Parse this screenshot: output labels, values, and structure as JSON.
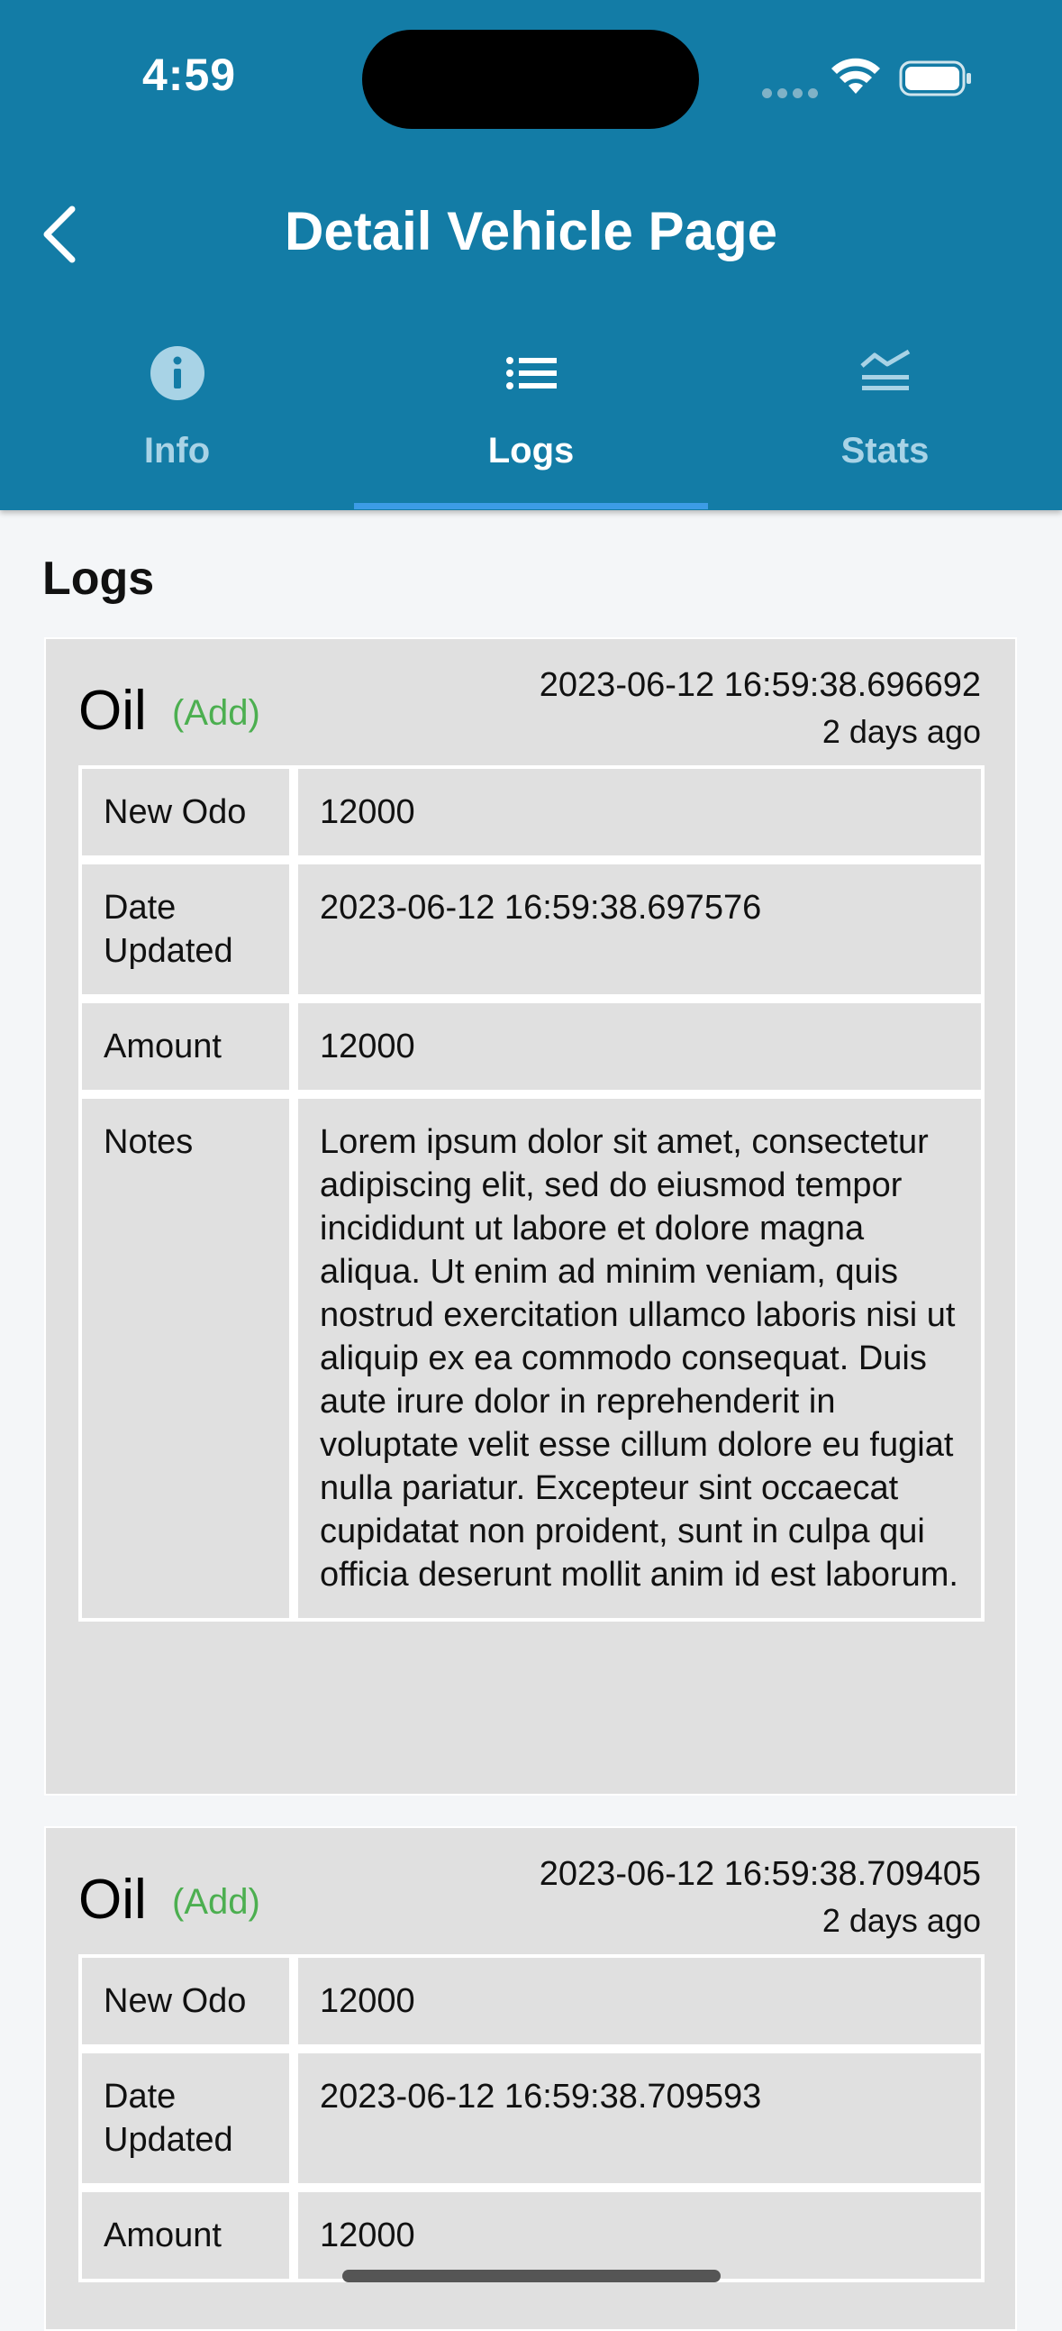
{
  "status_bar": {
    "time": "4:59"
  },
  "header": {
    "title": "Detail Vehicle Page"
  },
  "tabs": [
    {
      "label": "Info",
      "icon": "info-icon",
      "active": false
    },
    {
      "label": "Logs",
      "icon": "list-icon",
      "active": true
    },
    {
      "label": "Stats",
      "icon": "stats-icon",
      "active": false
    }
  ],
  "section_title": "Logs",
  "logs": [
    {
      "type": "Oil",
      "action": "(Add)",
      "timestamp": "2023-06-12 16:59:38.696692",
      "ago": "2 days ago",
      "rows": [
        {
          "key": "New Odo",
          "value": "12000"
        },
        {
          "key": "Date Updated",
          "value": "2023-06-12 16:59:38.697576"
        },
        {
          "key": "Amount",
          "value": "12000"
        },
        {
          "key": "Notes",
          "value": "Lorem ipsum dolor sit amet, consectetur adipiscing elit, sed do eiusmod tempor incididunt ut labore et dolore magna aliqua. Ut enim ad minim veniam, quis nostrud exercitation ullamco laboris nisi ut aliquip ex ea commodo consequat. Duis aute irure dolor in reprehenderit in voluptate velit esse cillum dolore eu fugiat nulla pariatur. Excepteur sint occaecat cupidatat non proident, sunt in culpa qui officia deserunt mollit anim id est laborum."
        }
      ]
    },
    {
      "type": "Oil",
      "action": "(Add)",
      "timestamp": "2023-06-12 16:59:38.709405",
      "ago": "2 days ago",
      "rows": [
        {
          "key": "New Odo",
          "value": "12000"
        },
        {
          "key": "Date Updated",
          "value": "2023-06-12 16:59:38.709593"
        },
        {
          "key": "Amount",
          "value": "12000"
        }
      ]
    }
  ],
  "colors": {
    "header_bg": "#137ca6",
    "tab_indicator": "#3c9ce6",
    "action_green": "#4caf50",
    "card_bg": "#e0e0e0",
    "page_bg": "#f4f6f8"
  }
}
